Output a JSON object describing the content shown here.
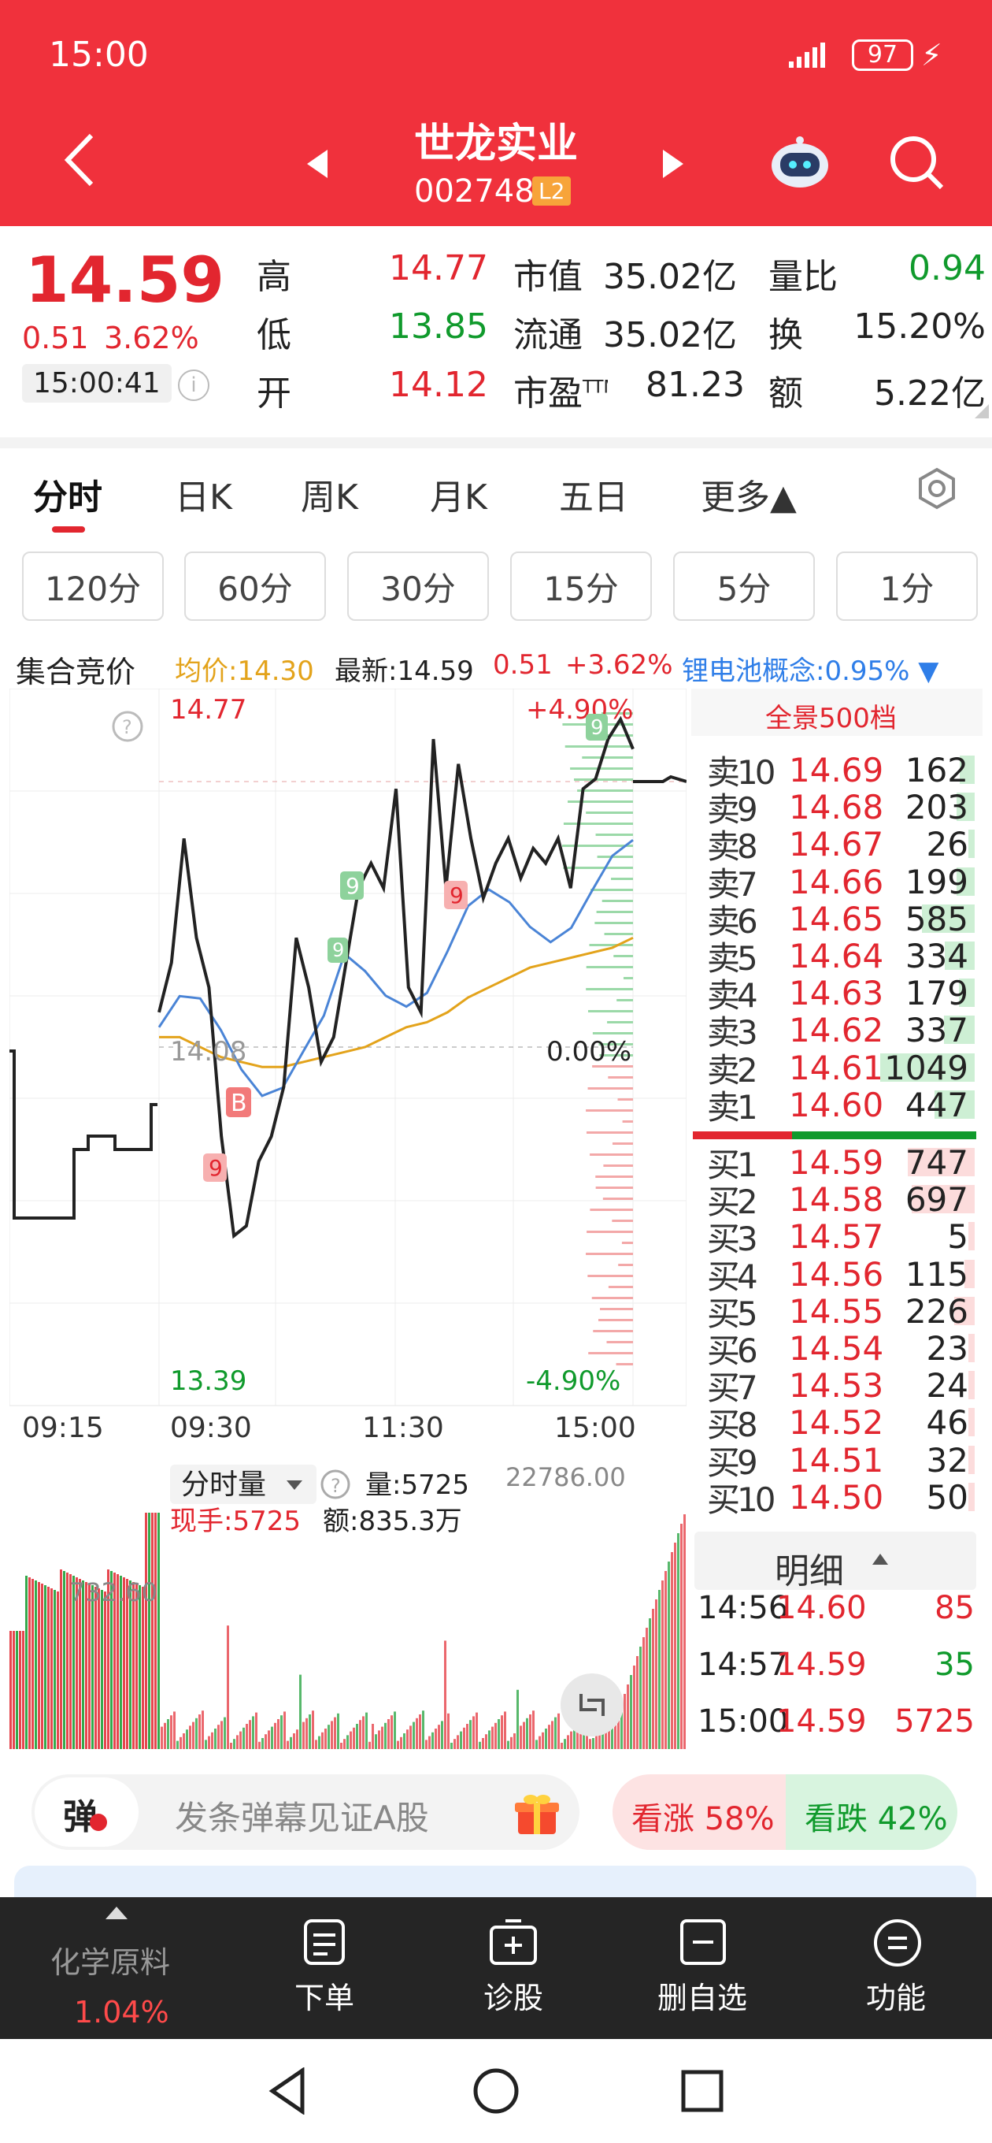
{
  "status_bar": {
    "time": "15:00",
    "battery": "97"
  },
  "header": {
    "title": "世龙实业",
    "code": "002748",
    "level": "L2"
  },
  "quote": {
    "price": "14.59",
    "change": "0.51",
    "change_pct": "3.62%",
    "time": "15:00:41",
    "high_label": "高",
    "high": "14.77",
    "low_label": "低",
    "low": "13.85",
    "open_label": "开",
    "open": "14.12",
    "mcap_label": "市值",
    "mcap": "35.02亿",
    "float_label": "流通",
    "float": "35.02亿",
    "pe_label": "市盈TTM",
    "pe": "81.23",
    "vr_label": "量比",
    "vr": "0.94",
    "turn_label": "换",
    "turn": "15.20%",
    "amt_label": "额",
    "amt": "5.22亿"
  },
  "tabs": [
    "分时",
    "日K",
    "周K",
    "月K",
    "五日",
    "更多▲"
  ],
  "intervals": [
    "120分",
    "60分",
    "30分",
    "15分",
    "5分",
    "1分"
  ],
  "chart_header": {
    "auction": "集合竞价",
    "avg": "均价:14.30",
    "latest": "最新:14.59",
    "chg": "0.51",
    "pct": "+3.62%",
    "concept": "锂电池概念:0.95% ▼"
  },
  "chart_data": {
    "type": "line",
    "y_max": "14.77",
    "y_min": "13.39",
    "y_ref": "14.08",
    "pct_max": "+4.90%",
    "pct_min": "-4.90%",
    "pct_ref": "0.00%",
    "x_labels": [
      "09:15",
      "09:30",
      "11:30",
      "15:00"
    ],
    "price_series": [
      14.15,
      14.25,
      14.5,
      14.3,
      14.2,
      13.9,
      13.7,
      13.72,
      13.85,
      13.9,
      14.0,
      14.3,
      14.2,
      14.05,
      14.1,
      14.25,
      14.4,
      14.45,
      14.4,
      14.6,
      14.2,
      14.15,
      14.7,
      14.4,
      14.65,
      14.5,
      14.38,
      14.45,
      14.5,
      14.42,
      14.48,
      14.45,
      14.5,
      14.4,
      14.6,
      14.62,
      14.7,
      14.74,
      14.68
    ],
    "avg_series": [
      14.1,
      14.1,
      14.08,
      14.06,
      14.05,
      14.04,
      14.04,
      14.05,
      14.06,
      14.07,
      14.08,
      14.1,
      14.12,
      14.13,
      14.15,
      14.18,
      14.2,
      14.22,
      14.24,
      14.25,
      14.26,
      14.27,
      14.28,
      14.3
    ]
  },
  "orderbook": {
    "title": "全景500档",
    "asks": [
      [
        "卖10",
        "14.69",
        "162"
      ],
      [
        "卖9",
        "14.68",
        "203"
      ],
      [
        "卖8",
        "14.67",
        "26"
      ],
      [
        "卖7",
        "14.66",
        "199"
      ],
      [
        "卖6",
        "14.65",
        "585"
      ],
      [
        "卖5",
        "14.64",
        "334"
      ],
      [
        "卖4",
        "14.63",
        "179"
      ],
      [
        "卖3",
        "14.62",
        "337"
      ],
      [
        "卖2",
        "14.61",
        "1049"
      ],
      [
        "卖1",
        "14.60",
        "447"
      ]
    ],
    "bids": [
      [
        "买1",
        "14.59",
        "747"
      ],
      [
        "买2",
        "14.58",
        "697"
      ],
      [
        "买3",
        "14.57",
        "5"
      ],
      [
        "买4",
        "14.56",
        "115"
      ],
      [
        "买5",
        "14.55",
        "226"
      ],
      [
        "买6",
        "14.54",
        "23"
      ],
      [
        "买7",
        "14.53",
        "24"
      ],
      [
        "买8",
        "14.52",
        "46"
      ],
      [
        "买9",
        "14.51",
        "32"
      ],
      [
        "买10",
        "14.50",
        "50"
      ]
    ]
  },
  "detail": {
    "title": "明细",
    "rows": [
      [
        "14:56",
        "14.60",
        "85"
      ],
      [
        "14:57",
        "14.59",
        "35"
      ],
      [
        "15:00",
        "14.59",
        "5725"
      ]
    ]
  },
  "volume": {
    "label": "分时量",
    "vol": "量:5725",
    "hand": "现手:5725",
    "amount": "额:835.3万",
    "max": "22786.00",
    "mid": "732.60"
  },
  "danmu": {
    "btn": "弹",
    "placeholder": "发条弹幕见证A股",
    "up": "看涨 58%",
    "down": "看跌 42%"
  },
  "bottom_nav": {
    "sector": "化学原料",
    "sector_pct": "1.04%",
    "items": [
      "下单",
      "诊股",
      "删自选",
      "功能"
    ]
  }
}
